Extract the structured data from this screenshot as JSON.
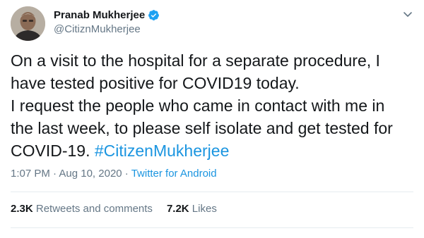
{
  "author": {
    "name": "Pranab Mukherjee",
    "handle": "@CitiznMukherjee",
    "verified": true
  },
  "tweet": {
    "line1": "On a visit to the hospital for a separate procedure, I",
    "line2": "have tested positive for COVID19 today.",
    "line3": "I request the people who came in contact with me in",
    "line4": "the last week, to please self isolate and get tested for",
    "line5_prefix": "COVID-19. ",
    "hashtag": "#CitizenMukherjee"
  },
  "meta": {
    "time": "1:07 PM",
    "separator": " · ",
    "date": "Aug 10, 2020",
    "source": "Twitter for Android"
  },
  "stats": {
    "retweets_count": "2.3K",
    "retweets_label": "Retweets and comments",
    "likes_count": "7.2K",
    "likes_label": "Likes"
  },
  "colors": {
    "link": "#1b95e0",
    "secondary": "#657786",
    "verified": "#1da1f2"
  },
  "icons": {
    "verified": "verified-badge-icon",
    "caret": "chevron-down-icon"
  }
}
